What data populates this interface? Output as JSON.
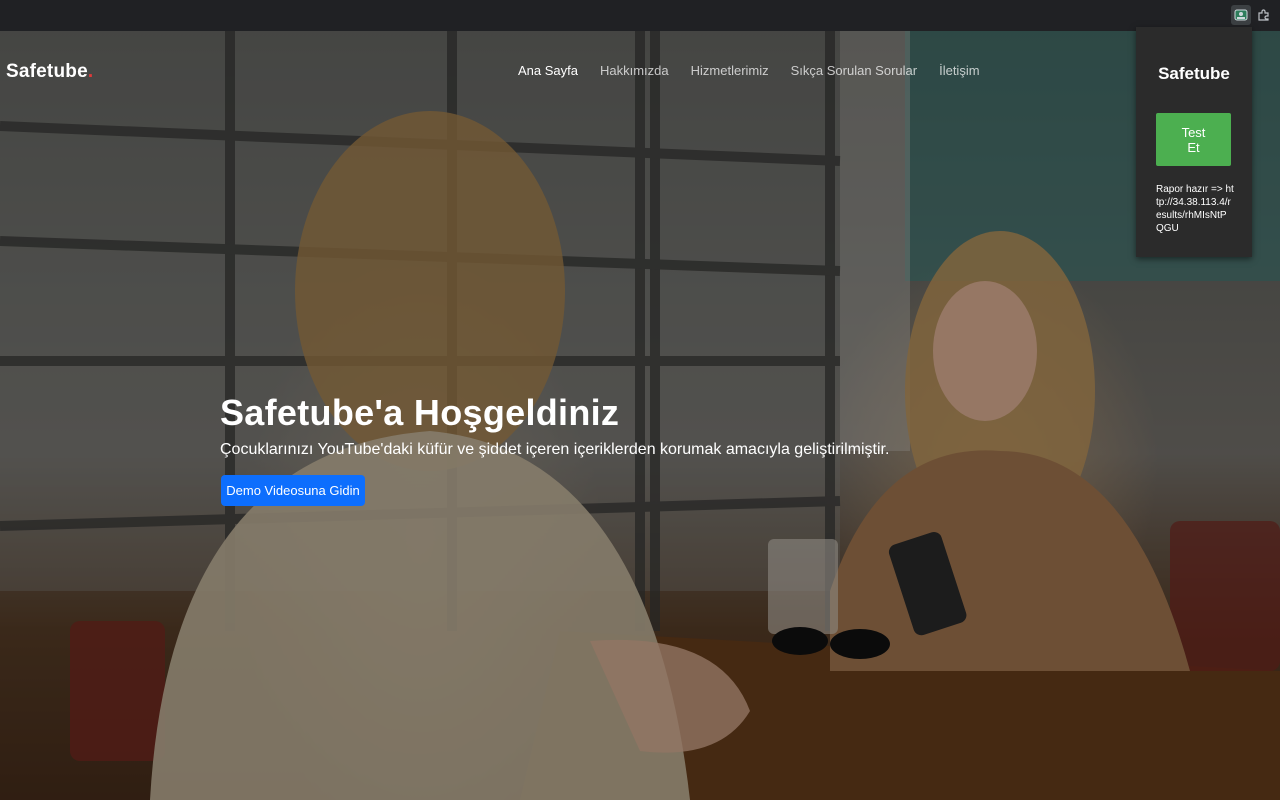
{
  "browser": {
    "extension_icons": [
      "safetube-extension-icon",
      "puzzle-icon"
    ]
  },
  "site": {
    "brand": "Safetube",
    "brand_dot": ".",
    "nav": [
      {
        "label": "Ana Sayfa",
        "active": true
      },
      {
        "label": "Hakkımızda",
        "active": false
      },
      {
        "label": "Hizmetlerimiz",
        "active": false
      },
      {
        "label": "Sıkça Sorulan Sorular",
        "active": false
      },
      {
        "label": "İletişim",
        "active": false
      }
    ]
  },
  "hero": {
    "title": "Safetube'a Hoşgeldiniz",
    "subtitle": "Çocuklarınızı YouTube'daki küfür ve şiddet içeren içeriklerden korumak amacıyla geliştirilmiştir.",
    "cta_label": "Demo Videosuna Gidin"
  },
  "popup": {
    "title": "Safetube",
    "button_label": "Test Et",
    "report_text": "Rapor hazır => http://34.38.113.4/results/rhMIsNtPQGU"
  },
  "colors": {
    "browser_bar": "#202124",
    "cta": "#0d6efd",
    "popup_bg": "#2b2b2b",
    "popup_button": "#4caf50",
    "brand_dot": "#e03a3a"
  }
}
